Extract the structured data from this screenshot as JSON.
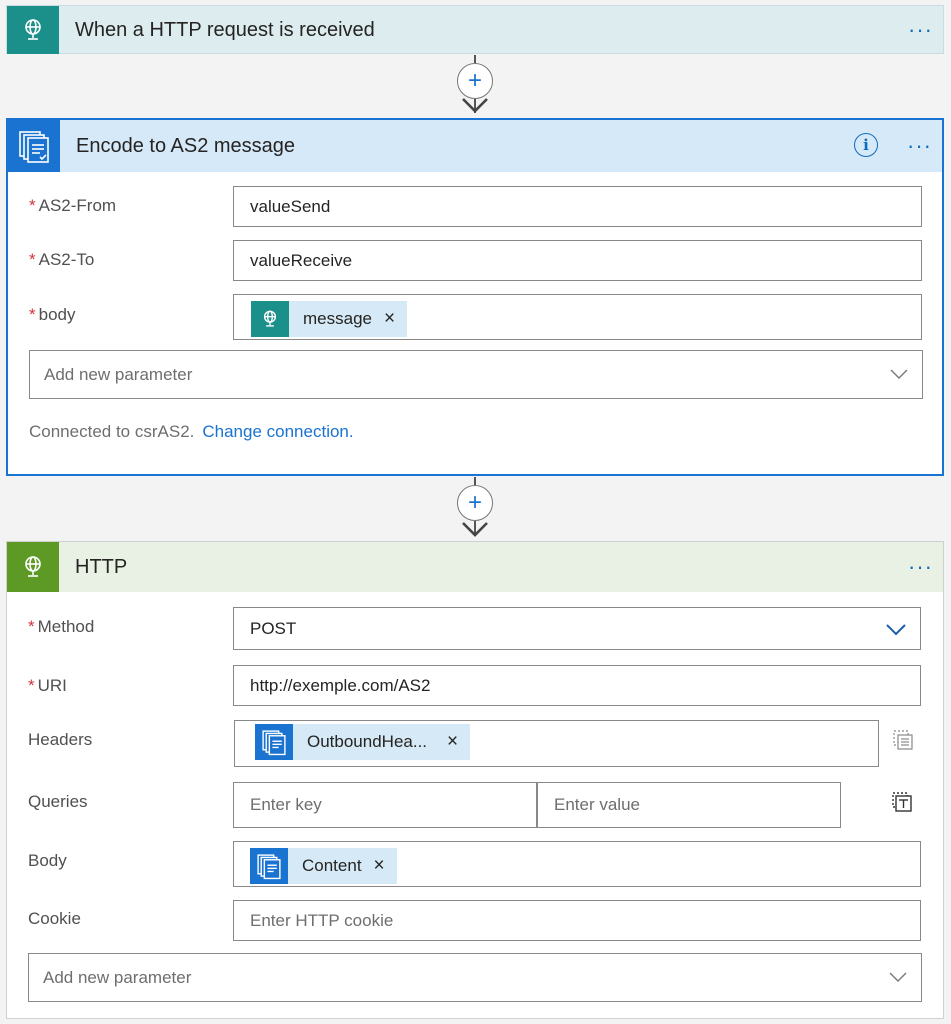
{
  "trigger": {
    "title": "When a HTTP request is received",
    "icon": "globe-request-icon",
    "more": "···"
  },
  "encode": {
    "title": "Encode to AS2 message",
    "icon": "documents-icon",
    "info": "i",
    "more": "···",
    "fields": {
      "as2_from": {
        "label": "AS2-From",
        "value": "valueSend"
      },
      "as2_to": {
        "label": "AS2-To",
        "value": "valueReceive"
      },
      "body": {
        "label": "body",
        "token": "message"
      }
    },
    "add_param_placeholder": "Add new parameter",
    "connection_text": "Connected to csrAS2.",
    "change_connection": "Change connection."
  },
  "http": {
    "title": "HTTP",
    "icon": "globe-icon",
    "more": "···",
    "method": {
      "label": "Method",
      "value": "POST"
    },
    "uri": {
      "label": "URI",
      "value": "http://exemple.com/AS2"
    },
    "headers": {
      "label": "Headers",
      "token": "OutboundHea..."
    },
    "queries": {
      "label": "Queries",
      "key_placeholder": "Enter key",
      "value_placeholder": "Enter value"
    },
    "body": {
      "label": "Body",
      "token": "Content"
    },
    "cookie": {
      "label": "Cookie",
      "placeholder": "Enter HTTP cookie"
    },
    "add_param_placeholder": "Add new parameter"
  },
  "required_mark": "*",
  "token_remove": "×",
  "plus": "+",
  "colors": {
    "accent": "#1a73d0",
    "trigger": "#1b8f8a",
    "http": "#5c9a25"
  }
}
